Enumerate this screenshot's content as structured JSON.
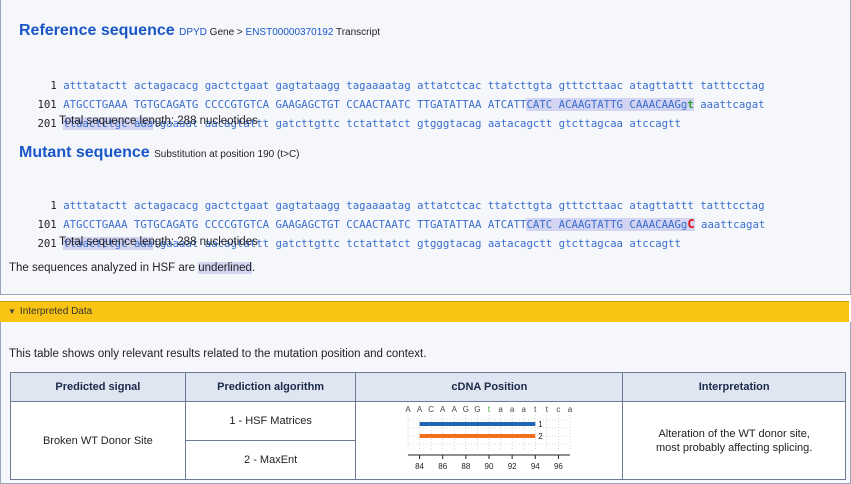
{
  "reference": {
    "title": "Reference sequence",
    "gene": "DPYD",
    "gene_suffix": " Gene > ",
    "transcript": "ENST00000370192",
    "transcript_suffix": " Transcript",
    "lines": [
      {
        "num": "1",
        "text": "atttatactt actagacacg gactctgaat gagtataagg tagaaaatag attatctcac ttatcttgta gtttcttaac atagttattt tatttcctag"
      },
      {
        "num": "101",
        "pre": "ATGCCTGAAA TGTGCAGATG CCCCGTGTCA GAAGAGCTGT CCAACTAATC TTGATATTAA ATCATT",
        "hl": "CATC ACAAGTATTG CAAACAAGg",
        "mut": "t",
        "post": " aaattcagat"
      },
      {
        "num": "201",
        "hl": "ttaactctgc aaa",
        "post": "tgaaaat aacagtattt gatcttgttc tctattatct gtgggtacag aatacagctt gtcttagcaa atccagtt"
      }
    ],
    "total": "Total sequence length: 288 nucleotides"
  },
  "mutant": {
    "title": "Mutant sequence",
    "subtitle": "Substitution at position 190 (t>C)",
    "lines": [
      {
        "num": "1",
        "text": "atttatactt actagacacg gactctgaat gagtataagg tagaaaatag attatctcac ttatcttgta gtttcttaac atagttattt tatttcctag"
      },
      {
        "num": "101",
        "pre": "ATGCCTGAAA TGTGCAGATG CCCCGTGTCA GAAGAGCTGT CCAACTAATC TTGATATTAA ATCATT",
        "hl": "CATC ACAAGTATTG CAAACAAGg",
        "mut": "C",
        "post": " aaattcagat"
      },
      {
        "num": "201",
        "hl": "ttaactctgc aaa",
        "post": "tgaaaat aacagtattt gatcttgttc tctattatct gtgggtacag aatacagctt gtcttagcaa atccagtt"
      }
    ],
    "total": "Total sequence length: 288 nucleotides"
  },
  "note": {
    "pre": "The sequences analyzed in HSF are ",
    "ul": "underlined",
    "post": "."
  },
  "interpreted": {
    "header": "Interpreted Data",
    "intro": "This table shows only relevant results related to the mutation position and context.",
    "columns": [
      "Predicted signal",
      "Prediction algorithm",
      "cDNA Position",
      "Interpretation"
    ],
    "signal": "Broken WT Donor Site",
    "algorithms": [
      "1 - HSF Matrices",
      "2 - MaxEnt"
    ],
    "interpretation_line1": "Alteration of the WT donor site,",
    "interpretation_line2": "most probably affecting splicing.",
    "mini_chart": {
      "letters": [
        "A",
        "A",
        "C",
        "A",
        "A",
        "G",
        "G",
        "t",
        "a",
        "a",
        "a",
        "t",
        "t",
        "c",
        "a"
      ],
      "letter_colors": [
        "#444444",
        "#444444",
        "#444444",
        "#444444",
        "#444444",
        "#444444",
        "#444444",
        "#2ca02c",
        "#444444",
        "#444444",
        "#444444",
        "#444444",
        "#444444",
        "#444444",
        "#444444"
      ],
      "x_range": [
        83,
        97
      ],
      "ticks": [
        84,
        86,
        88,
        90,
        92,
        94,
        96
      ],
      "bars": [
        {
          "label": "1",
          "start": 84,
          "end": 94,
          "color": "#1f66b3"
        },
        {
          "label": "2",
          "start": 84,
          "end": 94,
          "color": "#f07020"
        }
      ]
    }
  }
}
